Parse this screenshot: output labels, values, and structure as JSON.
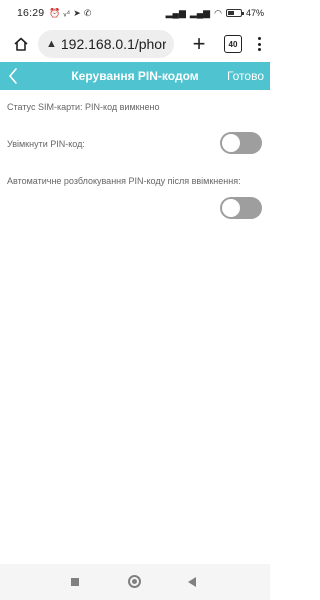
{
  "status_bar": {
    "time": "16:29",
    "battery": "47"
  },
  "browser": {
    "url_warning": "▲",
    "url": "192.168.0.1/phor",
    "tab_count": "40"
  },
  "header": {
    "title": "Керування PIN-кодом",
    "done_label": "Готово"
  },
  "content": {
    "sim_status": "Статус SIM-карти: PIN-код вимкнено",
    "enable_pin_label": "Увімкнути PIN-код:",
    "enable_pin_on": false,
    "auto_unlock_label": "Автоматичне розблокування PIN-коду після ввімкнення:",
    "auto_unlock_on": false
  },
  "colors": {
    "header_bg": "#4fc3cf",
    "toggle_off": "#9e9e9e"
  }
}
